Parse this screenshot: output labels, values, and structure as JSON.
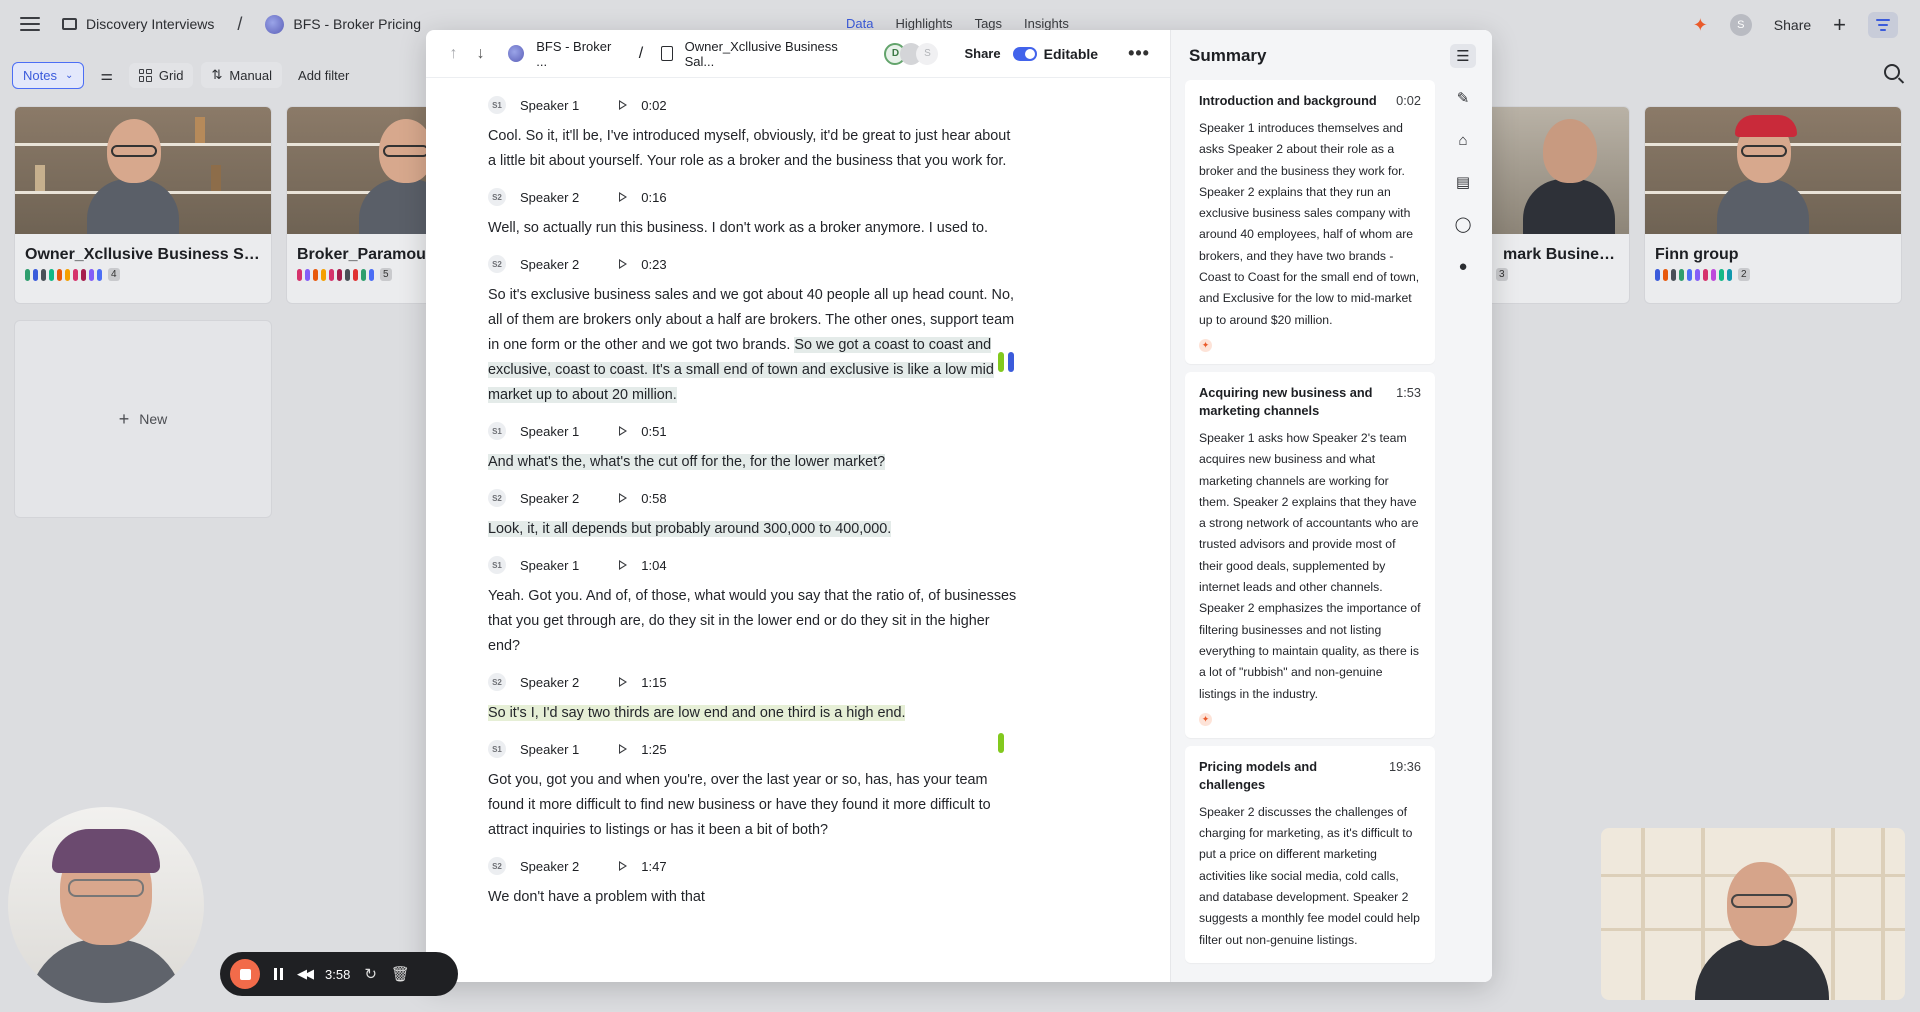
{
  "app": {
    "breadcrumb": [
      "Discovery Interviews",
      "BFS - Broker Pricing"
    ],
    "tabs": [
      "Data",
      "Highlights",
      "Tags",
      "Insights"
    ],
    "active_tab": "Data",
    "share_label": "Share",
    "user_initial": "S",
    "accent_color": "#3b5bdb"
  },
  "toolbar": {
    "notes_label": "Notes",
    "grid_label": "Grid",
    "manual_label": "Manual",
    "add_filter_label": "Add filter"
  },
  "cards": [
    {
      "title": "Owner_Xcllusive Business Sal...",
      "count": "4"
    },
    {
      "title": "Broker_Paramour",
      "count": "5"
    },
    {
      "title": "mark Business...",
      "count": "3"
    },
    {
      "title": "Finn group",
      "count": "2"
    }
  ],
  "new_card_label": "New",
  "modal": {
    "project": "BFS - Broker ...",
    "doc": "Owner_Xcllusive Business Sal...",
    "avatar_d": "D",
    "avatar_s": "S",
    "share_label": "Share",
    "editable_label": "Editable"
  },
  "transcript": [
    {
      "badge": "S1",
      "speaker": "Speaker 1",
      "time": "0:02",
      "parts": [
        {
          "t": "Cool. So it, it'll be, I've introduced myself, obviously, it'd be great to just hear about a little bit about yourself. Your role as a broker and the business that you work for.",
          "h": ""
        }
      ]
    },
    {
      "badge": "S2",
      "speaker": "Speaker 2",
      "time": "0:16",
      "parts": [
        {
          "t": "Well, so actually run this business. I don't work as a broker anymore. I used to.",
          "h": ""
        }
      ]
    },
    {
      "badge": "S2",
      "speaker": "Speaker 2",
      "time": "0:23",
      "parts": [
        {
          "t": "So it's exclusive business sales and we got about 40 people all up head count. No, all of them are brokers only about a half are brokers. The other ones, support team in one form or the other and we got two brands. ",
          "h": ""
        },
        {
          "t": "So we got a coast to coast and exclusive, coast to coast. It's a small end of town and exclusive is like a low mid market up to about 20 million.",
          "h": "hl"
        }
      ]
    },
    {
      "badge": "S1",
      "speaker": "Speaker 1",
      "time": "0:51",
      "parts": [
        {
          "t": "And what's the, what's the cut off for the, for the lower market?",
          "h": "hl"
        }
      ]
    },
    {
      "badge": "S2",
      "speaker": "Speaker 2",
      "time": "0:58",
      "parts": [
        {
          "t": "Look, it, it all depends but probably around 300,000 to 400,000.",
          "h": "hl"
        }
      ]
    },
    {
      "badge": "S1",
      "speaker": "Speaker 1",
      "time": "1:04",
      "parts": [
        {
          "t": "Yeah. Got you. And of, of those, what would you say that the ratio of, of businesses that you get through are, do they sit in the lower end or do they sit in the higher end?",
          "h": ""
        }
      ]
    },
    {
      "badge": "S2",
      "speaker": "Speaker 2",
      "time": "1:15",
      "parts": [
        {
          "t": "So it's I, I'd say two thirds are low end and one third is a high end.",
          "h": "hl-g"
        }
      ]
    },
    {
      "badge": "S1",
      "speaker": "Speaker 1",
      "time": "1:25",
      "parts": [
        {
          "t": "Got you, got you and when you're, over the last year or so, has, has your team found it more difficult to find new business or have they found it more difficult to attract inquiries to listings or has it been a bit of both?",
          "h": ""
        }
      ]
    },
    {
      "badge": "S2",
      "speaker": "Speaker 2",
      "time": "1:47",
      "parts": [
        {
          "t": "We don't have a problem with that",
          "h": ""
        }
      ]
    }
  ],
  "summary": {
    "title": "Summary",
    "items": [
      {
        "heading": "Introduction and background",
        "time": "0:02",
        "body": "Speaker 1 introduces themselves and asks Speaker 2 about their role as a broker and the business they work for. Speaker 2 explains that they run an exclusive business sales company with around 40 employees, half of whom are brokers, and they have two brands - Coast to Coast for the small end of town, and Exclusive for the low to mid-market up to around $20 million."
      },
      {
        "heading": "Acquiring new business and marketing channels",
        "time": "1:53",
        "body": "Speaker 1 asks how Speaker 2's team acquires new business and what marketing channels are working for them. Speaker 2 explains that they have a strong network of accountants who are trusted advisors and provide most of their good deals, supplemented by internet leads and other channels. Speaker 2 emphasizes the importance of filtering businesses and not listing everything to maintain quality, as there is a lot of \"rubbish\" and non-genuine listings in the industry."
      },
      {
        "heading": "Pricing models and challenges",
        "time": "19:36",
        "body": "Speaker 2 discusses the challenges of charging for marketing, as it's difficult to put a price on different marketing activities like social media, cold calls, and database development. Speaker 2 suggests a monthly fee model could help filter out non-genuine listings."
      }
    ]
  },
  "recorder": {
    "time": "3:58",
    "stop_color": "#f26b4a"
  }
}
